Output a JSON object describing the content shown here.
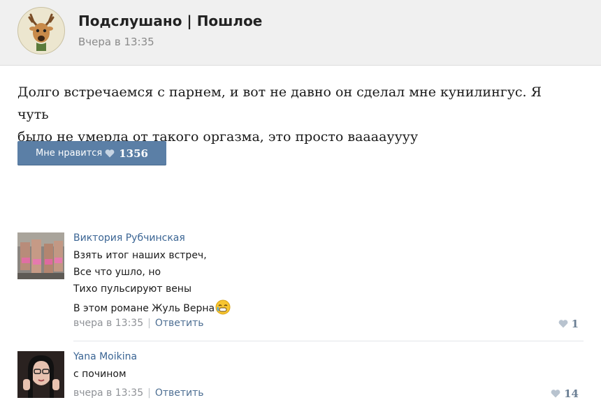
{
  "post": {
    "group_name": "Подслушано | Пошлое",
    "time": "Вчера в 13:35",
    "text_line1": "Долго встречаемся с парнем, и вот не давно он сделал мне кунилингус. Я чуть",
    "text_line2": "было не умерла от такого оргазма, это просто ваааауууу",
    "like_label": "Мне нравится",
    "like_count": "1356"
  },
  "comments": [
    {
      "author": "Виктория Рубчинская",
      "lines": [
        "Взять итог наших встреч,",
        "Все что ушло, но",
        "Тихо пульсируют вены",
        "В этом романе Жуль Верна"
      ],
      "time": "вчера в 13:35",
      "separator": "|",
      "reply": "Ответить",
      "likes": "1"
    },
    {
      "author": "Yana Moikina",
      "lines": [
        "с почином"
      ],
      "time": "вчера в 13:35",
      "separator": "|",
      "reply": "Ответить",
      "likes": "14"
    }
  ],
  "colors": {
    "accent": "#5b7fa6",
    "link": "#3b6594",
    "header_bg": "#f0f0f0"
  },
  "icons": [
    "deer-logo-icon",
    "heart-icon",
    "tear-emoji-icon"
  ]
}
